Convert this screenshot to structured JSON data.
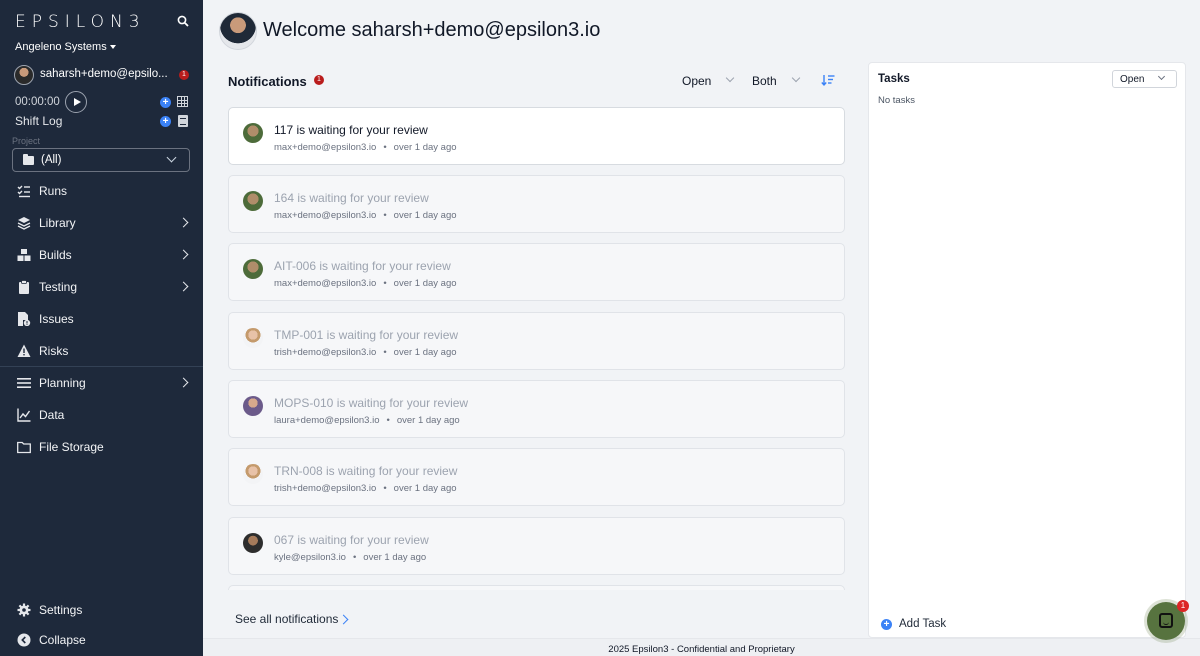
{
  "sidebar": {
    "logo": "EPSILON3",
    "org_name": "Angeleno Systems",
    "user_name": "saharsh+demo@epsilo...",
    "user_badge": "1",
    "timer": "00:00:00",
    "shift_log": "Shift Log",
    "project_label": "Project",
    "project_value": "(All)",
    "nav": [
      {
        "label": "Runs",
        "icon": "checklist-icon"
      },
      {
        "label": "Library",
        "icon": "layers-icon"
      },
      {
        "label": "Builds",
        "icon": "cubes-icon"
      },
      {
        "label": "Testing",
        "icon": "clipboard-icon"
      },
      {
        "label": "Issues",
        "icon": "file-alert-icon"
      },
      {
        "label": "Risks",
        "icon": "warning-icon"
      },
      {
        "label": "Planning",
        "icon": "menu-icon"
      },
      {
        "label": "Data",
        "icon": "line-chart-icon"
      },
      {
        "label": "File Storage",
        "icon": "folder-icon"
      }
    ],
    "settings": "Settings",
    "collapse": "Collapse"
  },
  "header": {
    "welcome": "Welcome saharsh+demo@epsilon3.io"
  },
  "notifications": {
    "title": "Notifications",
    "badge": "1",
    "filter_status": "Open",
    "filter_type": "Both",
    "items": [
      {
        "title": "117 is waiting for your review",
        "email": "max+demo@epsilon3.io",
        "time": "over 1 day ago",
        "unread": true
      },
      {
        "title": "164 is waiting for your review",
        "email": "max+demo@epsilon3.io",
        "time": "over 1 day ago",
        "unread": false
      },
      {
        "title": "AIT-006 is waiting for your review",
        "email": "max+demo@epsilon3.io",
        "time": "over 1 day ago",
        "unread": false
      },
      {
        "title": "TMP-001 is waiting for your review",
        "email": "trish+demo@epsilon3.io",
        "time": "over 1 day ago",
        "unread": false
      },
      {
        "title": "MOPS-010 is waiting for your review",
        "email": "laura+demo@epsilon3.io",
        "time": "over 1 day ago",
        "unread": false
      },
      {
        "title": "TRN-008 is waiting for your review",
        "email": "trish+demo@epsilon3.io",
        "time": "over 1 day ago",
        "unread": false
      },
      {
        "title": "067 is waiting for your review",
        "email": "kyle@epsilon3.io",
        "time": "over 1 day ago",
        "unread": false
      }
    ],
    "see_all": "See all notifications"
  },
  "tasks": {
    "title": "Tasks",
    "filter": "Open",
    "empty": "No tasks",
    "add": "Add Task"
  },
  "footer": "2025 Epsilon3 - Confidential and Proprietary",
  "chat_badge": "1",
  "colors": {
    "sidebar_bg": "#1e293b",
    "accent": "#3b82f6",
    "badge": "#b91c1c"
  }
}
